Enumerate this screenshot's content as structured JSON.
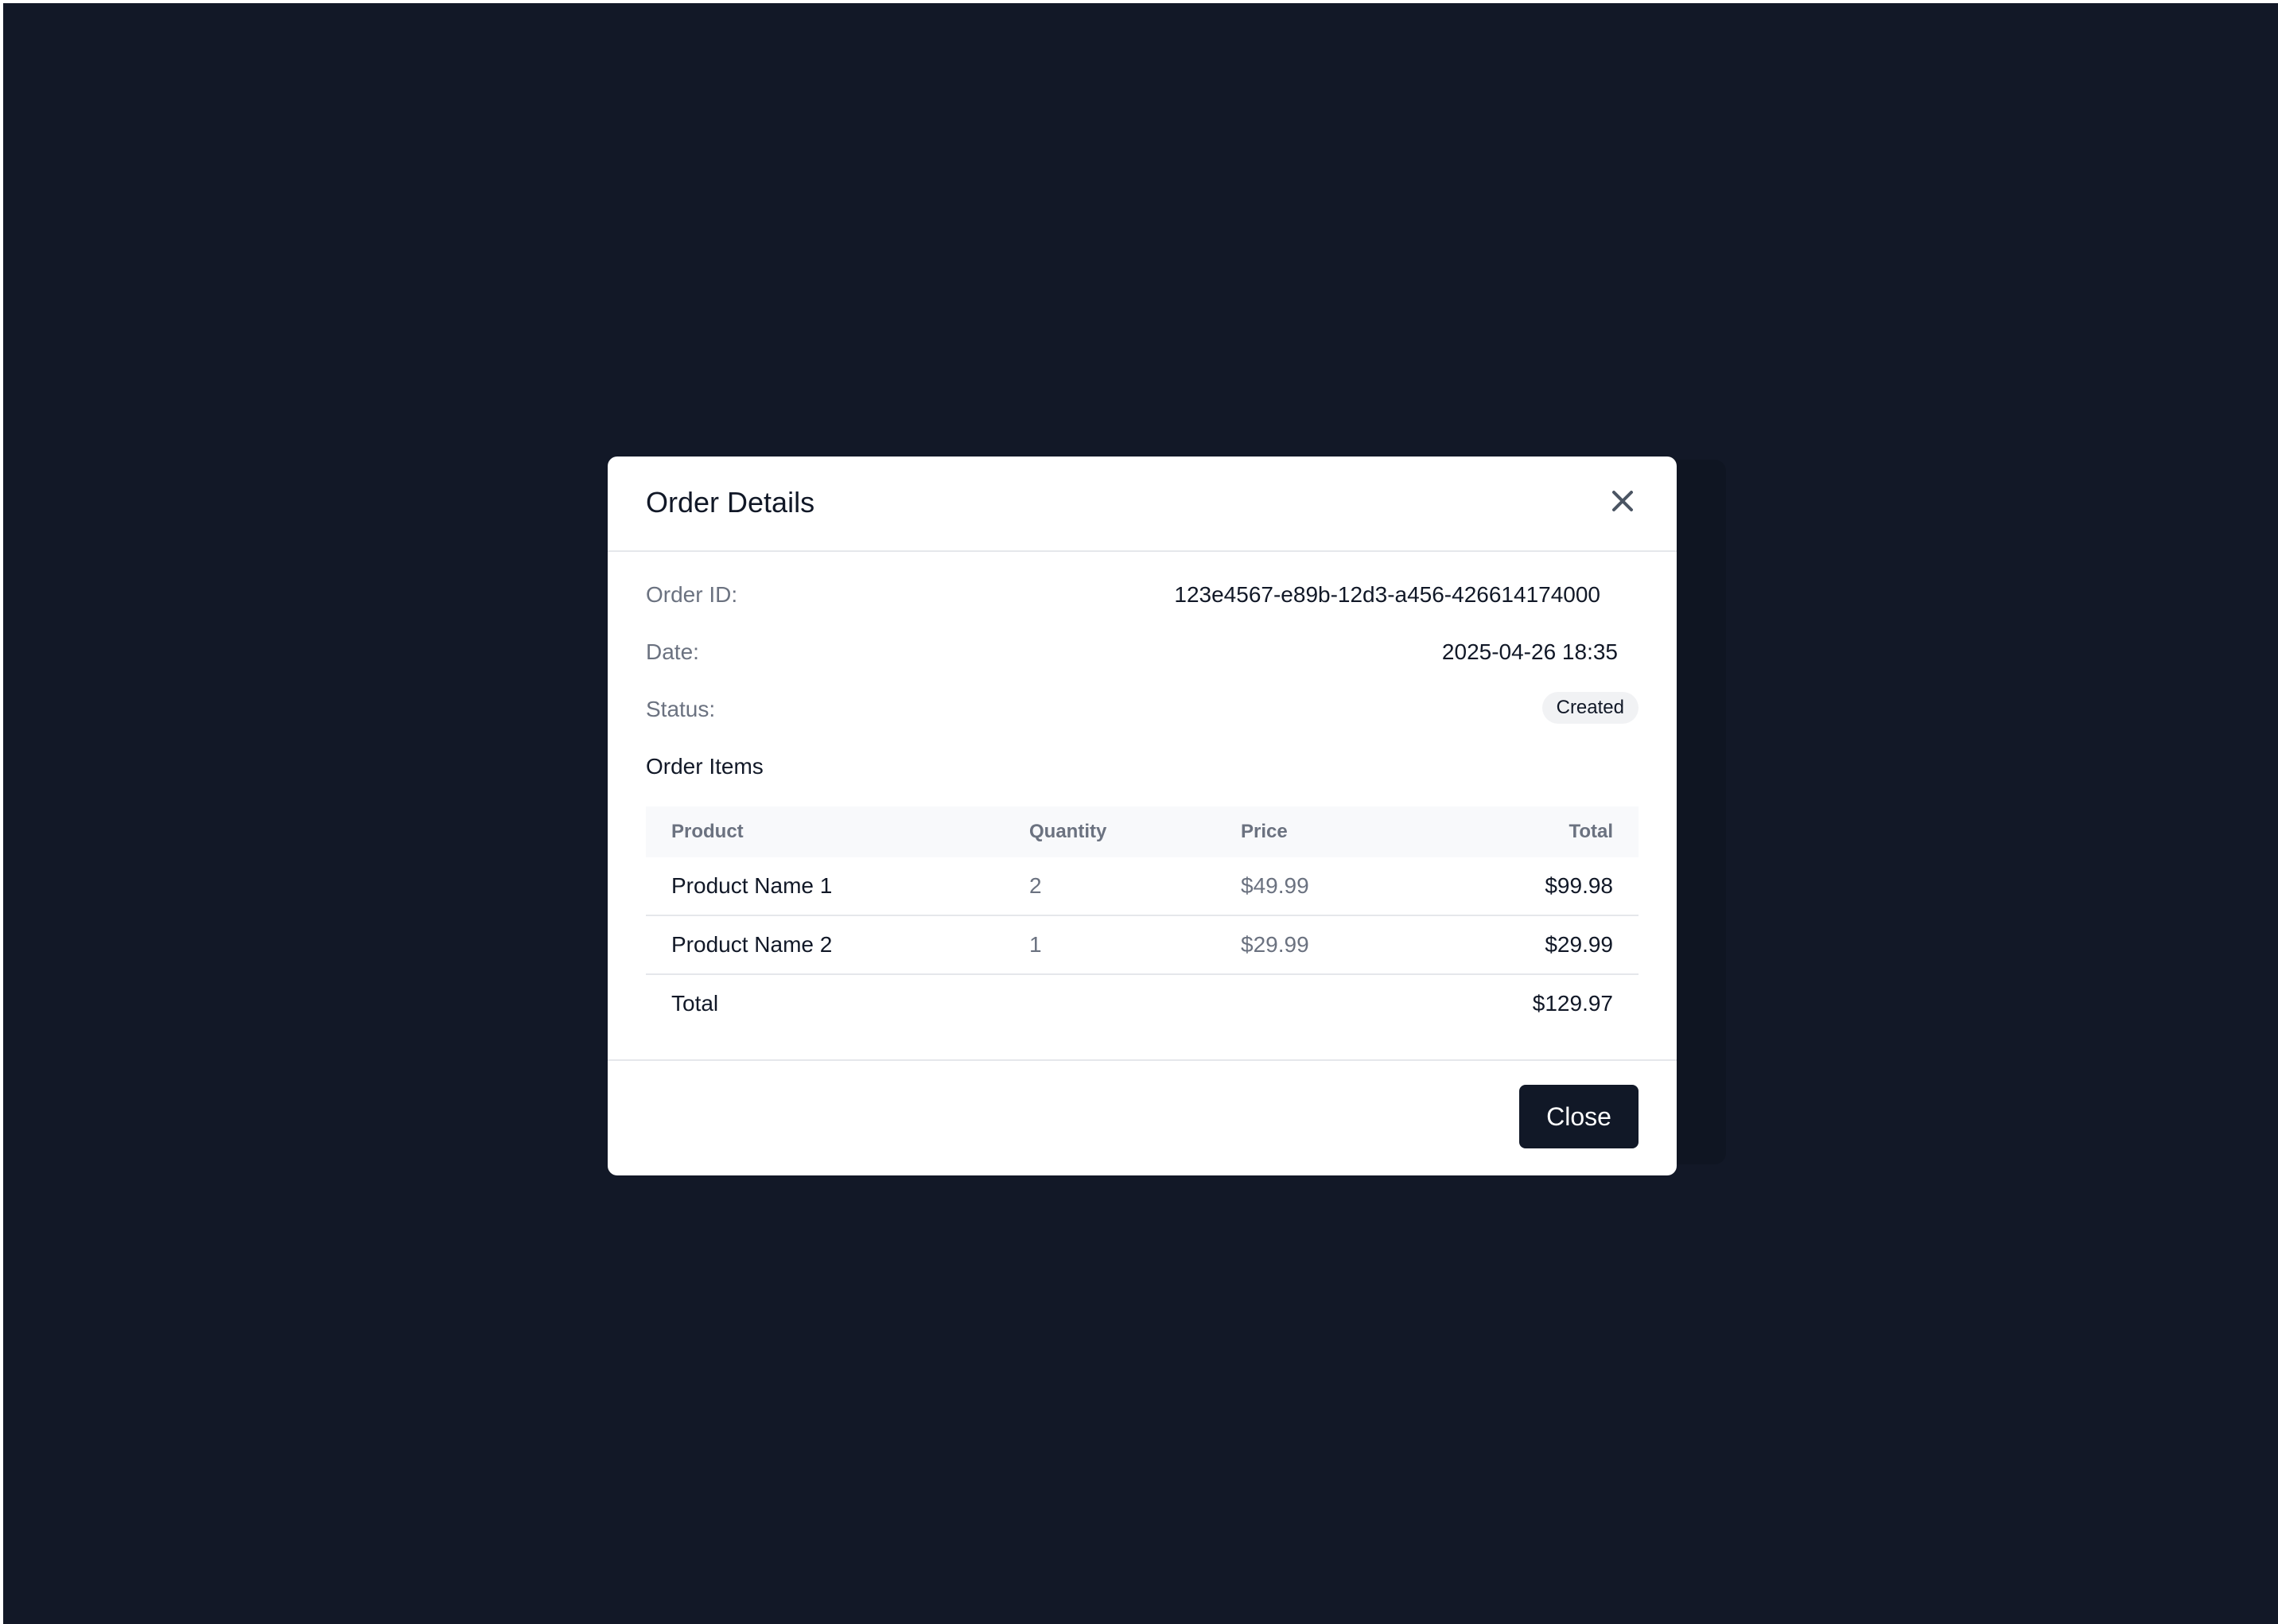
{
  "modal": {
    "title": "Order Details",
    "close_icon": "close-icon"
  },
  "order": {
    "id_label": "Order ID:",
    "id_value": "123e4567-e89b-12d3-a456-426614174000",
    "date_label": "Date:",
    "date_value": "2025-04-26 18:35",
    "status_label": "Status:",
    "status_value": "Created"
  },
  "items": {
    "section_title": "Order Items",
    "columns": [
      "Product",
      "Quantity",
      "Price",
      "Total"
    ],
    "rows": [
      {
        "product": "Product Name 1",
        "quantity": "2",
        "price": "$49.99",
        "total": "$99.98"
      },
      {
        "product": "Product Name 2",
        "quantity": "1",
        "price": "$29.99",
        "total": "$29.99"
      }
    ],
    "total_label": "Total",
    "total_value": "$129.97"
  },
  "footer": {
    "close_label": "Close"
  },
  "colors": {
    "backdrop": "#121827",
    "button": "#111827",
    "muted_text": "#6b7280",
    "badge_bg": "#f1f2f4"
  }
}
